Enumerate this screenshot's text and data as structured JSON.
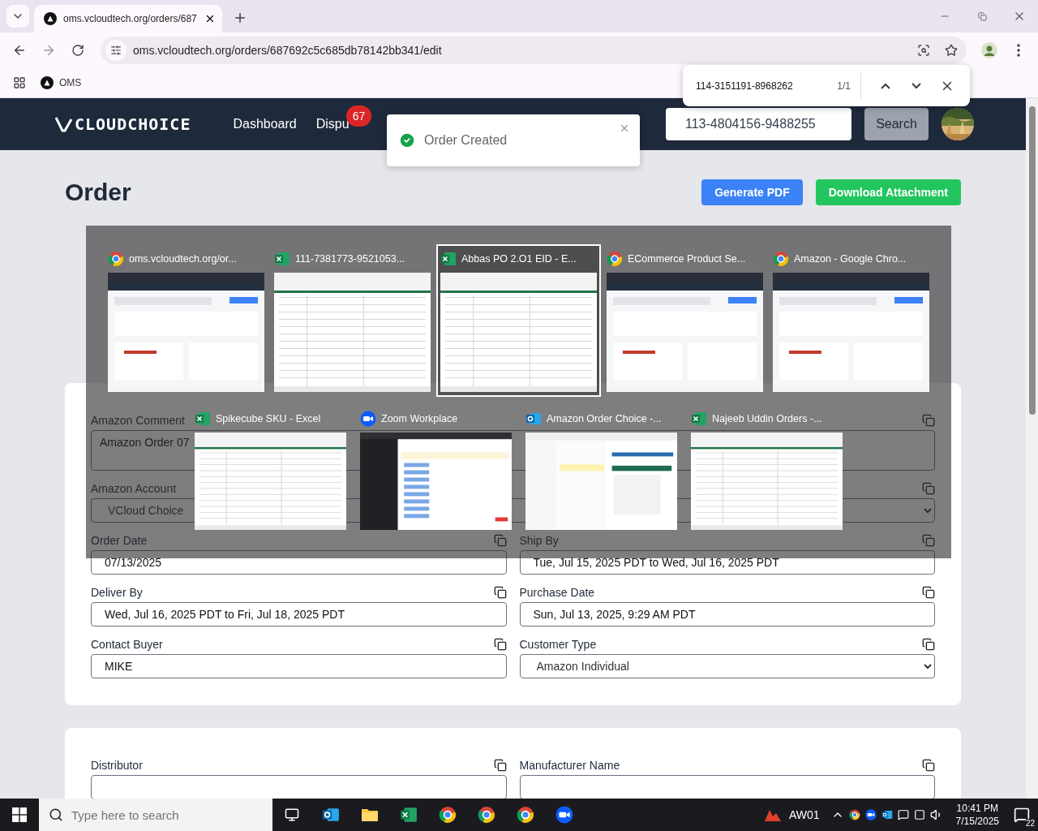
{
  "browser": {
    "tabs": [
      {
        "title": "oms.vcloudtech.org/orders/687",
        "selected": true
      }
    ],
    "url": "oms.vcloudtech.org/orders/687692c5c685db78142bb341/edit",
    "bookmarks": [
      {
        "label": "OMS"
      }
    ],
    "find_bar": {
      "query": "114-3151191-8968262",
      "count": "1/1"
    }
  },
  "nav": {
    "logo": "CLOUDCHOICE",
    "links": [
      {
        "label": "Dashboard"
      },
      {
        "label": "Dispu",
        "badge": "67"
      }
    ],
    "search": {
      "value": "113-4804156-9488255",
      "button": "Search"
    }
  },
  "toast": {
    "message": "Order Created"
  },
  "page": {
    "title": "Order",
    "actions": [
      {
        "label": "Generate PDF",
        "color": "#3b82f6"
      },
      {
        "label": "Download Attachment",
        "color": "#22c55e"
      }
    ]
  },
  "cards": [
    {
      "fields": [
        {
          "label": "Amazon Comment",
          "value": "Amazon Order 07",
          "kind": "textarea",
          "full_width": true
        },
        {
          "label": "Amazon Account",
          "value": "VCloud Choice",
          "kind": "select",
          "full_width": true
        },
        {
          "label": "Order Date",
          "value": "07/13/2025",
          "kind": "text",
          "full_width": false
        },
        {
          "label": "Ship By",
          "value": "Tue, Jul 15, 2025 PDT to Wed, Jul 16, 2025 PDT",
          "kind": "text",
          "full_width": false
        },
        {
          "label": "Deliver By",
          "value": "Wed, Jul 16, 2025 PDT to Fri, Jul 18, 2025 PDT",
          "kind": "text",
          "full_width": false
        },
        {
          "label": "Purchase Date",
          "value": "Sun, Jul 13, 2025, 9:29 AM PDT",
          "kind": "text",
          "full_width": false
        },
        {
          "label": "Contact Buyer",
          "value": "MIKE",
          "kind": "text",
          "full_width": false
        },
        {
          "label": "Customer Type",
          "value": "Amazon Individual",
          "kind": "select",
          "full_width": false
        }
      ]
    },
    {
      "fields": [
        {
          "label": "Distributor",
          "kind": "text",
          "full_width": false
        },
        {
          "label": "Manufacturer Name",
          "kind": "text",
          "full_width": false
        }
      ]
    }
  ],
  "switcher": {
    "windows": [
      {
        "title": "oms.vcloudtech.org/or...",
        "kind": "browser",
        "selected": false
      },
      {
        "title": "111-7381773-9521053...",
        "kind": "spreadsheet",
        "selected": false
      },
      {
        "title": "Abbas PO 2.O1  EID - E...",
        "kind": "spreadsheet",
        "selected": true
      },
      {
        "title": "ECommerce Product Se...",
        "kind": "browser",
        "selected": false
      },
      {
        "title": "Amazon - Google Chro...",
        "kind": "browser",
        "selected": false
      },
      {
        "title": "Spikecube SKU - Excel",
        "kind": "spreadsheet",
        "selected": false
      },
      {
        "title": "Zoom Workplace",
        "kind": "meeting",
        "selected": false
      },
      {
        "title": "Amazon Order Choice -...",
        "kind": "mail",
        "selected": false
      },
      {
        "title": "Najeeb Uddin Orders -...",
        "kind": "spreadsheet",
        "selected": false
      }
    ]
  },
  "taskbar": {
    "search_placeholder": "Type here to search",
    "weather": "AW01",
    "time": "10:41 PM",
    "date": "7/15/2025",
    "notifications": "22"
  }
}
